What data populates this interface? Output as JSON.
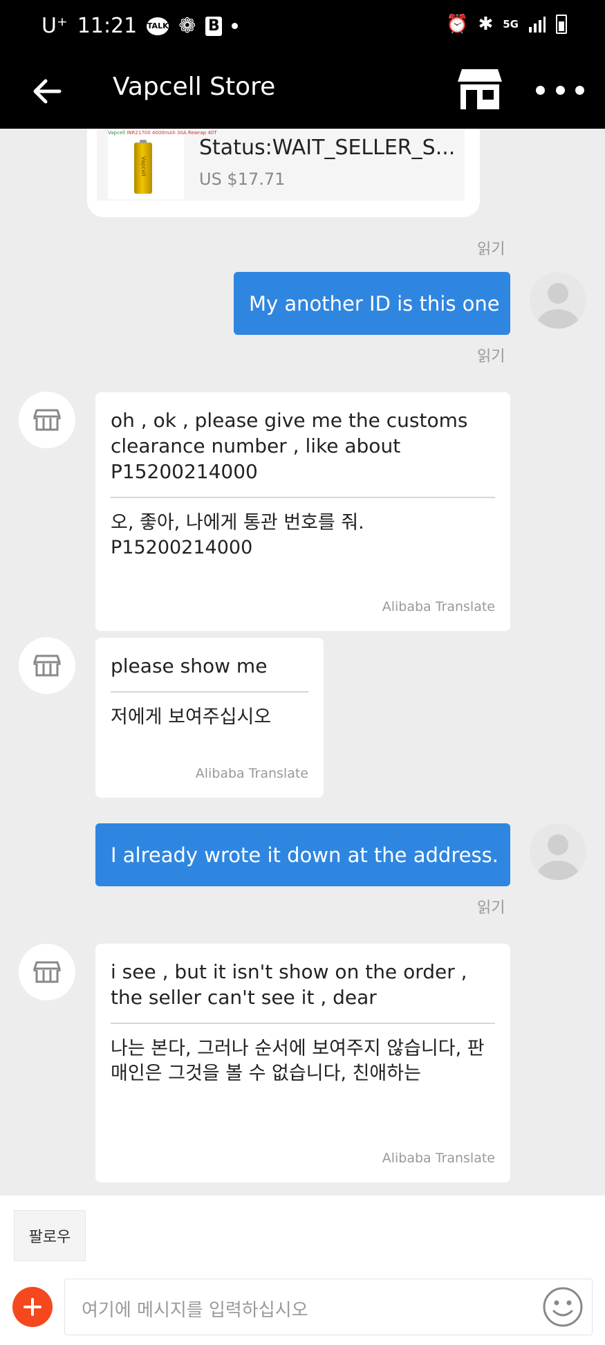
{
  "status_bar": {
    "carrier": "U⁺",
    "time": "11:21",
    "kakao_badge": "TALK",
    "b_badge": "B",
    "network_badge": "5G"
  },
  "header": {
    "back_icon": "arrow-left-icon",
    "title": "Vapcell Store",
    "store_icon": "storefront-icon",
    "more_icon": "more-dots-icon"
  },
  "product": {
    "thumb_caption": "INR21700 4000mAh 30A Rewrap 40T",
    "thumb_brand": "Vapcell",
    "status": "Status:WAIT_SELLER_S...",
    "price": "US $17.71"
  },
  "messages": [
    {
      "direction": "out",
      "text": "My another ID is this one",
      "read_label": "읽기"
    },
    {
      "direction": "in",
      "text": "oh , ok , please give me the customs clearance number , like about P15200214000",
      "translation": "오, 좋아, 나에게 통관 번호를 줘. P15200214000",
      "translated_by": "Alibaba Translate"
    },
    {
      "direction": "in",
      "text": "please show me",
      "translation": "저에게 보여주십시오",
      "translated_by": "Alibaba Translate"
    },
    {
      "direction": "out",
      "text": "I already wrote it down at the address.",
      "read_label": "읽기"
    },
    {
      "direction": "in",
      "text": "i see , but it isn't show on the order , the seller can't see it , dear",
      "translation": "나는 본다, 그러나 순서에 보여주지 않습니다, 판매인은 그것을 볼 수 없습니다, 친애하는",
      "translated_by": "Alibaba Translate"
    }
  ],
  "top_read_label": "읽기",
  "composer": {
    "follow_label": "팔로우",
    "placeholder": "여기에 메시지를 입력하십시오",
    "plus_icon": "plus-icon",
    "emoji_icon": "smiley-icon"
  },
  "colors": {
    "outgoing_bubble": "#2f86e0",
    "plus_button": "#f5481e",
    "header": "#000000"
  }
}
